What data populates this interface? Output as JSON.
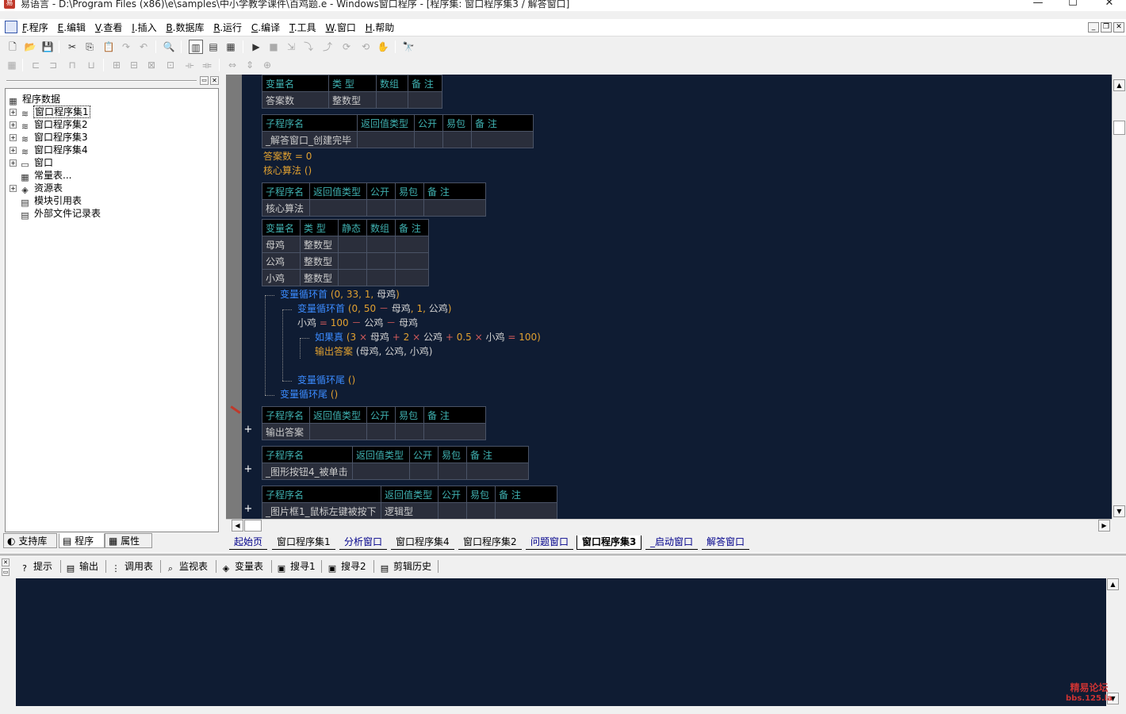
{
  "window": {
    "title": "易语言 - D:\\Program Files (x86)\\e\\samples\\中小学教学课件\\百鸡题.e - Windows窗口程序 - [程序集: 窗口程序集3 / 解答窗口]",
    "app_icon": "易",
    "min": "—",
    "max": "☐",
    "close": "✕"
  },
  "menu": {
    "items": [
      {
        "key": "F",
        "label": ".程序"
      },
      {
        "key": "E",
        "label": ".编辑"
      },
      {
        "key": "V",
        "label": ".查看"
      },
      {
        "key": "I",
        "label": ".插入"
      },
      {
        "key": "B",
        "label": ".数据库"
      },
      {
        "key": "R",
        "label": ".运行"
      },
      {
        "key": "C",
        "label": ".编译"
      },
      {
        "key": "T",
        "label": ".工具"
      },
      {
        "key": "W",
        "label": ".窗口"
      },
      {
        "key": "H",
        "label": ".帮助"
      }
    ],
    "mdi": [
      "_",
      "❐",
      "✕"
    ]
  },
  "toolbar1": {
    "icons": [
      "new-file-icon",
      "open-folder-icon",
      "save-icon",
      "cut-icon",
      "copy-icon",
      "paste-icon",
      "redo-icon",
      "undo-icon",
      "find-icon",
      "layout-1-icon",
      "layout-2-icon",
      "layout-3-icon",
      "run-icon",
      "stop-icon",
      "step-icon",
      "step-into-icon",
      "step-out-icon",
      "step-over-icon",
      "hand-icon",
      "lib-icon"
    ]
  },
  "toolbar2": {
    "icons": [
      "t2a-icon",
      "t2b-icon",
      "t2c-icon",
      "t2d-icon",
      "t2e-icon",
      "t2f-icon",
      "t2g-icon",
      "t2h-icon",
      "t2i-icon",
      "t2j-icon",
      "t2k-icon",
      "t2l-icon",
      "t2m-icon",
      "t2n-icon"
    ]
  },
  "tree": {
    "root": "程序数据",
    "items": [
      {
        "label": "窗口程序集1",
        "exp": true,
        "icon": "≋"
      },
      {
        "label": "窗口程序集2",
        "exp": true,
        "icon": "≋"
      },
      {
        "label": "窗口程序集3",
        "exp": true,
        "icon": "≋"
      },
      {
        "label": "窗口程序集4",
        "exp": true,
        "icon": "≋"
      },
      {
        "label": "窗口",
        "exp": true,
        "icon": "▭"
      },
      {
        "label": "常量表...",
        "exp": false,
        "icon": "▦"
      },
      {
        "label": "资源表",
        "exp": true,
        "icon": "◈"
      },
      {
        "label": "模块引用表",
        "exp": false,
        "icon": "▤"
      },
      {
        "label": "外部文件记录表",
        "exp": false,
        "icon": "▤"
      }
    ]
  },
  "left_tabs": [
    {
      "label": "支持库",
      "icon": "◐"
    },
    {
      "label": "程序",
      "icon": "▤"
    },
    {
      "label": "属性",
      "icon": "▦"
    }
  ],
  "code": {
    "vars_header": [
      "变量名",
      "类 型",
      "数组",
      "备 注"
    ],
    "vars_row": [
      "答案数",
      "整数型",
      "",
      ""
    ],
    "sub_header_a": [
      "子程序名",
      "返回值类型",
      "公开",
      "易包",
      "备 注"
    ],
    "sub1_name": "_解答窗口_创建完毕",
    "line1": {
      "a": "答案数",
      "b": "=",
      "c": "0"
    },
    "line2": {
      "a": "核心算法",
      "b": "()"
    },
    "sub2_name": "核心算法",
    "locals_header": [
      "变量名",
      "类 型",
      "静态",
      "数组",
      "备 注"
    ],
    "locals": [
      {
        "n": "母鸡",
        "t": "整数型"
      },
      {
        "n": "公鸡",
        "t": "整数型"
      },
      {
        "n": "小鸡",
        "t": "整数型"
      }
    ],
    "loop1": "变量循环首",
    "loop1_args": {
      "p": "(",
      "a": "0",
      "s1": ",",
      "b": "33",
      "s2": ",",
      "c": "1",
      "s3": ",",
      "d": "母鸡",
      "e": ")"
    },
    "loop2": "变量循环首",
    "loop2_args": {
      "p": "(",
      "a": "0",
      "s1": ",",
      "b": "50",
      "m": "－",
      "c": "母鸡",
      "s2": ",",
      "d": "1",
      "s3": ",",
      "e": "公鸡",
      "f": ")"
    },
    "assign": {
      "a": "小鸡",
      "eq": "=",
      "b": "100",
      "m1": "－",
      "c": "公鸡",
      "m2": "－",
      "d": "母鸡"
    },
    "ifline": {
      "kw": "如果真",
      "p": "(",
      "a": "3",
      "x1": "×",
      "b": "母鸡",
      "p1": "+",
      "c": "2",
      "x2": "×",
      "d": "公鸡",
      "p2": "+",
      "e": "0.5",
      "x3": "×",
      "f": "小鸡",
      "eq": "=",
      "g": "100",
      "q": ")"
    },
    "output": {
      "fn": "输出答案",
      "args": "(母鸡, 公鸡, 小鸡)"
    },
    "loop2end": {
      "kw": "变量循环尾",
      "a": "()"
    },
    "loop1end": {
      "kw": "变量循环尾",
      "a": "()"
    },
    "sub3_name": "输出答案",
    "sub4_name": "_图形按钮4_被单击",
    "sub5_name": "_图片框1_鼠标左键被按下",
    "sub5_ret": "逻辑型",
    "plus": "+"
  },
  "doc_tabs": [
    {
      "label": "起始页",
      "active": false
    },
    {
      "label": "窗口程序集1",
      "active": false
    },
    {
      "label": "分析窗口",
      "active": false
    },
    {
      "label": "窗口程序集4",
      "active": false
    },
    {
      "label": "窗口程序集2",
      "active": false
    },
    {
      "label": "问题窗口",
      "active": false
    },
    {
      "label": "窗口程序集3",
      "active": true
    },
    {
      "label": "_启动窗口",
      "active": false
    },
    {
      "label": "解答窗口",
      "active": false
    }
  ],
  "bottom_tabs": [
    {
      "label": "提示",
      "icon": "?"
    },
    {
      "label": "输出",
      "icon": "▤"
    },
    {
      "label": "调用表",
      "icon": "⋮"
    },
    {
      "label": "监视表",
      "icon": "⌕"
    },
    {
      "label": "变量表",
      "icon": "◈"
    },
    {
      "label": "搜寻1",
      "icon": "▣"
    },
    {
      "label": "搜寻2",
      "icon": "▣"
    },
    {
      "label": "剪辑历史",
      "icon": "▤"
    }
  ],
  "watermark": {
    "line1": "精易论坛",
    "line2": "bbs.125.la"
  }
}
